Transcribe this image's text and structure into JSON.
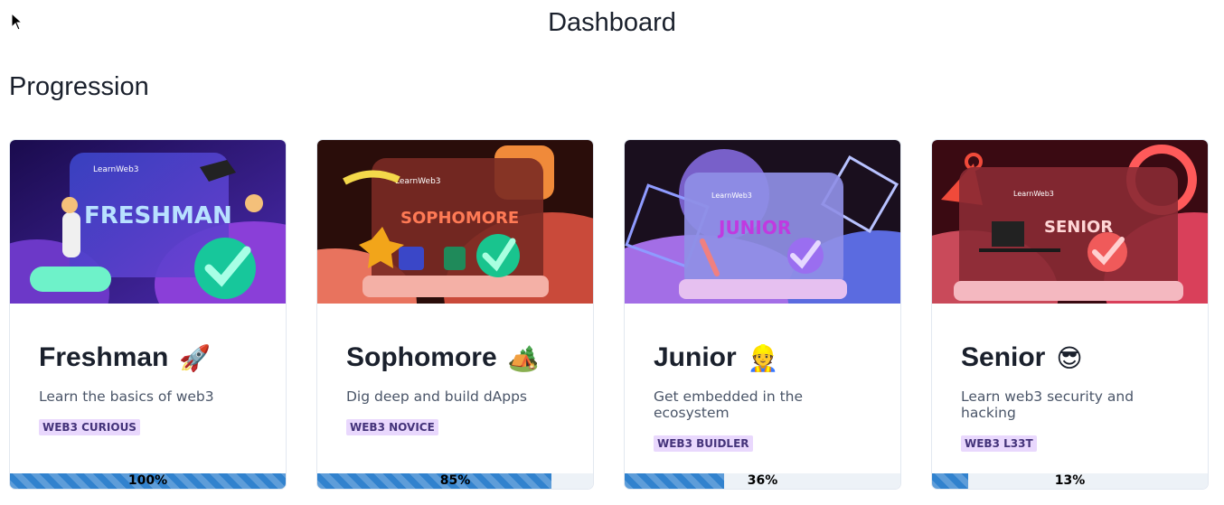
{
  "header": {
    "title": "Dashboard"
  },
  "section": {
    "title": "Progression"
  },
  "cards": [
    {
      "image_logo": "LearnWeb3",
      "image_label": "FRESHMAN",
      "title": "Freshman",
      "emoji": "🚀",
      "description": "Learn the basics of web3",
      "badge": "WEB3 CURIOUS",
      "progress": 100,
      "progress_label": "100%"
    },
    {
      "image_logo": "LearnWeb3",
      "image_label": "SOPHOMORE",
      "title": "Sophomore",
      "emoji": "🏕️",
      "description": "Dig deep and build dApps",
      "badge": "WEB3 NOVICE",
      "progress": 85,
      "progress_label": "85%"
    },
    {
      "image_logo": "LearnWeb3",
      "image_label": "JUNIOR",
      "title": "Junior",
      "emoji": "👷",
      "description": "Get embedded in the ecosystem",
      "badge": "WEB3 BUIDLER",
      "progress": 36,
      "progress_label": "36%"
    },
    {
      "image_logo": "LearnWeb3",
      "image_label": "SENIOR",
      "title": "Senior",
      "emoji": "😎",
      "description": "Learn web3 security and hacking",
      "badge": "WEB3 L33T",
      "progress": 13,
      "progress_label": "13%"
    }
  ],
  "colors": {
    "accent": "#3182ce",
    "badge_bg": "#e9d8fd",
    "badge_text": "#44337a",
    "title_underline": "#7c5cff"
  }
}
